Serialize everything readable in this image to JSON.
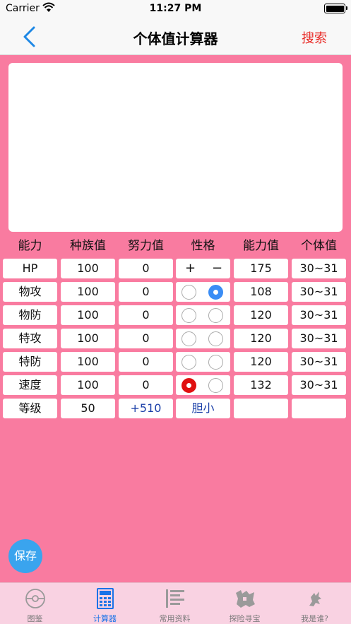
{
  "status_bar": {
    "carrier": "Carrier",
    "time": "11:27 PM"
  },
  "nav": {
    "title": "个体值计算器",
    "search": "搜索"
  },
  "colors": {
    "background": "#f97ba0",
    "accent": "#3a8df5",
    "danger": "#e01010"
  },
  "table": {
    "headers": [
      "能力",
      "种族值",
      "努力值",
      "性格",
      "能力值",
      "个体值"
    ],
    "rows": [
      {
        "stat": "HP",
        "base": "100",
        "ev": "0",
        "nature": "plus-minus",
        "plus": "+",
        "minus": "−",
        "value": "175",
        "iv": "30~31"
      },
      {
        "stat": "物攻",
        "base": "100",
        "ev": "0",
        "nature": "right",
        "value": "108",
        "iv": "30~31"
      },
      {
        "stat": "物防",
        "base": "100",
        "ev": "0",
        "nature": "none",
        "value": "120",
        "iv": "30~31"
      },
      {
        "stat": "特攻",
        "base": "100",
        "ev": "0",
        "nature": "none",
        "value": "120",
        "iv": "30~31"
      },
      {
        "stat": "特防",
        "base": "100",
        "ev": "0",
        "nature": "none",
        "value": "120",
        "iv": "30~31"
      },
      {
        "stat": "速度",
        "base": "100",
        "ev": "0",
        "nature": "left",
        "value": "132",
        "iv": "30~31"
      }
    ],
    "level_row": {
      "label": "等级",
      "level": "50",
      "ev_total": "+510",
      "nature_name": "胆小"
    }
  },
  "save_button": "保存",
  "tabs": [
    {
      "label": "图鉴",
      "icon": "pokeball-icon",
      "active": false
    },
    {
      "label": "计算器",
      "icon": "calculator-icon",
      "active": true
    },
    {
      "label": "常用资料",
      "icon": "list-icon",
      "active": false
    },
    {
      "label": "探险寻宝",
      "icon": "map-icon",
      "active": false
    },
    {
      "label": "我是谁?",
      "icon": "silhouette-icon",
      "active": false
    }
  ]
}
